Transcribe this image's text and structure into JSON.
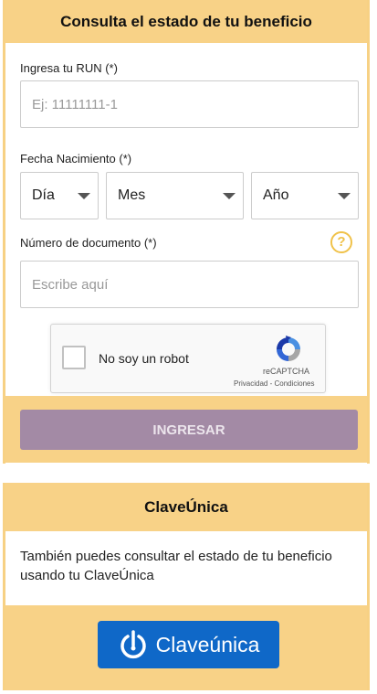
{
  "card1": {
    "title": "Consulta el estado de tu beneficio",
    "run_label": "Ingresa tu RUN (*)",
    "run_placeholder": "Ej: 11111111-1",
    "birth_label": "Fecha Nacimiento (*)",
    "day_select": "Día",
    "month_select": "Mes",
    "year_select": "Año",
    "doc_label": "Número de documento (*)",
    "doc_placeholder": "Escribe aquí",
    "help_icon": "?",
    "recaptcha": {
      "label": "No soy un robot",
      "brand": "reCAPTCHA",
      "links": "Privacidad - Condiciones"
    },
    "submit_label": "INGRESAR"
  },
  "card2": {
    "title": "ClaveÚnica",
    "text": "También puedes consultar el estado de tu beneficio usando tu ClaveÚnica",
    "button_label": "Claveúnica"
  },
  "colors": {
    "band": "#f8d287",
    "submit_button": "#a38aa5",
    "claveunica_button": "#0f68c8",
    "help_icon": "#f0c24a"
  }
}
